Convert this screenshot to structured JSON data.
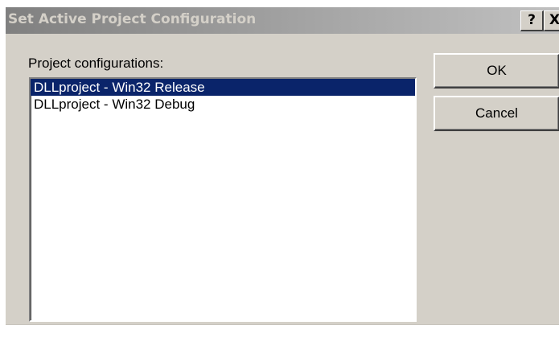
{
  "dialog": {
    "title": "Set Active Project Configuration",
    "help_button": "?",
    "close_button": "X",
    "list_label": "Project configurations:",
    "configurations": [
      {
        "label": "DLLproject - Win32 Release",
        "selected": true
      },
      {
        "label": "DLLproject - Win32 Debug",
        "selected": false
      }
    ],
    "ok_label": "OK",
    "cancel_label": "Cancel"
  },
  "colors": {
    "selection": "#0a246a",
    "dialog_face": "#d4d0c8"
  }
}
